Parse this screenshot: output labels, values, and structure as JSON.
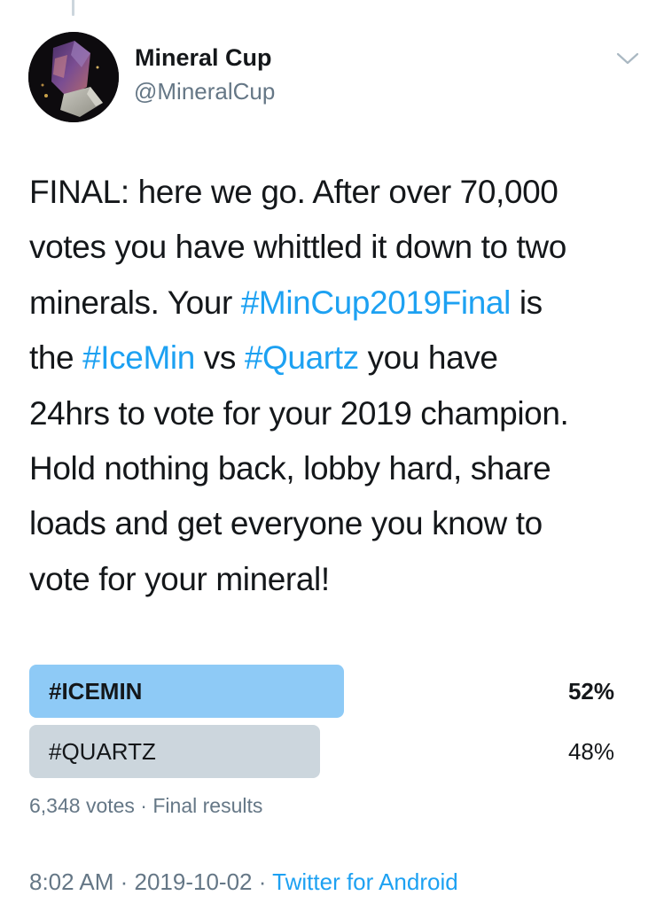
{
  "author": {
    "name": "Mineral Cup",
    "handle": "@MineralCup"
  },
  "tweet": {
    "lines": [
      [
        {
          "text": "FINAL: here we go. After over 70,000"
        }
      ],
      [
        {
          "text": "votes you have whittled it down to two"
        }
      ],
      [
        {
          "text": "minerals. Your "
        },
        {
          "text": "#MinCup2019Final",
          "hashtag": true
        },
        {
          "text": " is"
        }
      ],
      [
        {
          "text": "the "
        },
        {
          "text": "#IceMin",
          "hashtag": true
        },
        {
          "text": " vs "
        },
        {
          "text": "#Quartz",
          "hashtag": true
        },
        {
          "text": " you have"
        }
      ],
      [
        {
          "text": "24hrs to vote for your 2019 champion."
        }
      ],
      [
        {
          "text": "Hold nothing back, lobby hard, share"
        }
      ],
      [
        {
          "text": "loads and get everyone you know to"
        }
      ],
      [
        {
          "text": "vote for your mineral!"
        }
      ]
    ]
  },
  "poll": {
    "options": [
      {
        "label": "#ICEMIN",
        "percent_label": "52%",
        "fraction": 0.52,
        "winner": true
      },
      {
        "label": "#QUARTZ",
        "percent_label": "48%",
        "fraction": 0.48,
        "winner": false
      }
    ],
    "votes": "6,348 votes",
    "separator": " · ",
    "status": "Final results"
  },
  "footer": {
    "time": "8:02 AM",
    "separator": " · ",
    "date": "2019-10-02",
    "source": "Twitter for Android"
  },
  "colors": {
    "link": "#1da1f2",
    "winner_bar": "#8ecaf6",
    "loser_bar": "#ccd6dd",
    "secondary_text": "#657786"
  },
  "icons": {
    "more": "chevron-down-icon",
    "avatar": "mineral-crystal-avatar"
  }
}
